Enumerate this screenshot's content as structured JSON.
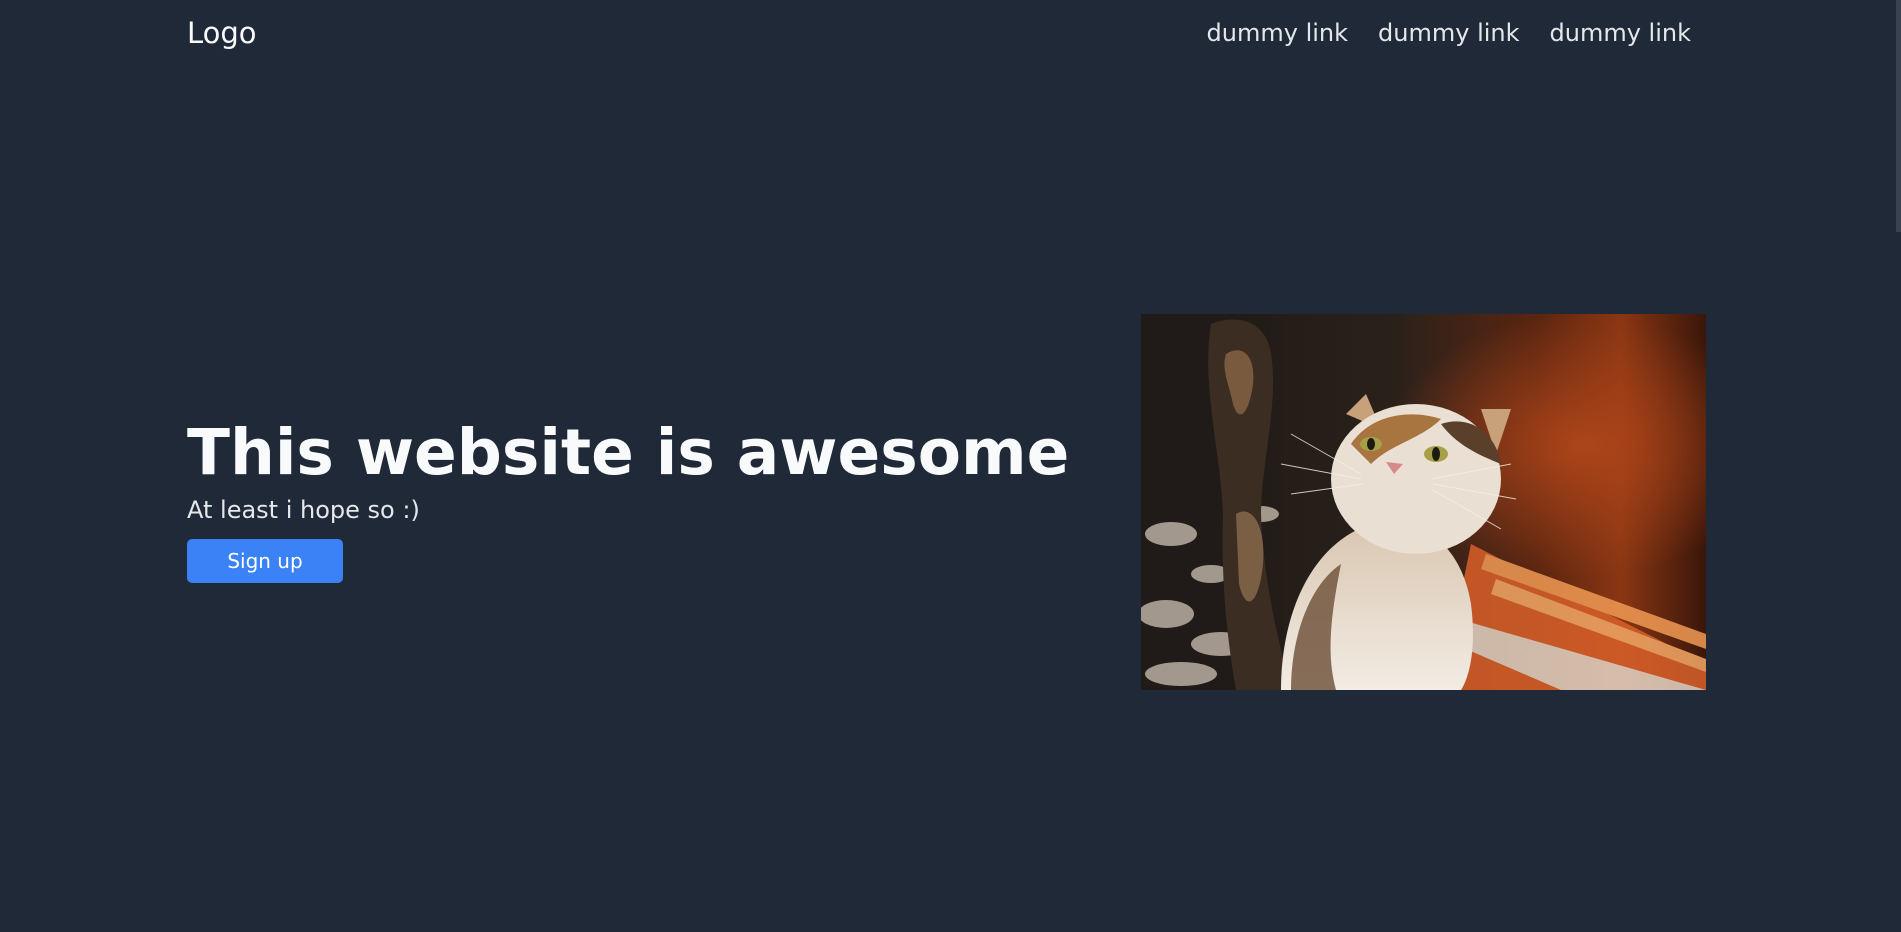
{
  "header": {
    "logo": "Logo",
    "nav_links": [
      "dummy link",
      "dummy link",
      "dummy link"
    ]
  },
  "hero": {
    "title": "This website is awesome",
    "subtitle": "At least i hope so :)",
    "cta_label": "Sign up"
  },
  "colors": {
    "background": "#1f2937",
    "accent": "#3b82f6",
    "text": "#f9fafb"
  }
}
